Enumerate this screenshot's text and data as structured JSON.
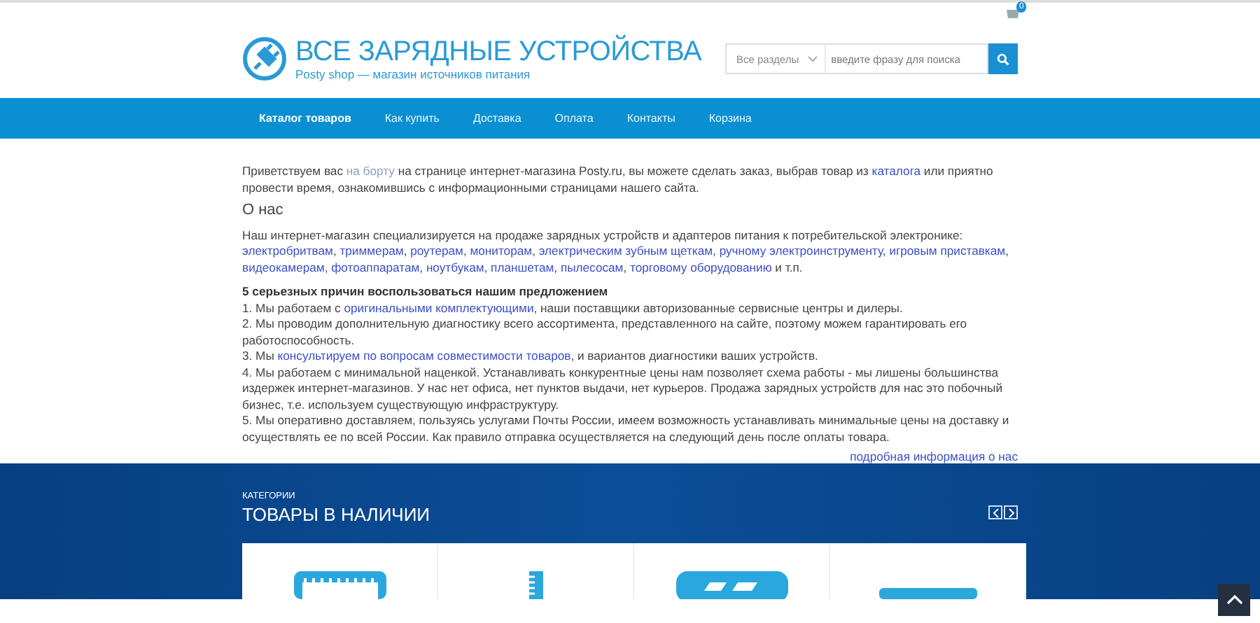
{
  "cart": {
    "count": "0"
  },
  "logo": {
    "title": "ВСЕ ЗАРЯДНЫЕ УСТРОЙСТВА",
    "subtitle": "Posty shop — магазин источников питания"
  },
  "search": {
    "section": "Все разделы",
    "placeholder": "введите фразу для поиска"
  },
  "nav": [
    {
      "label": "Каталог товаров",
      "selected": true
    },
    {
      "label": "Как купить",
      "selected": false
    },
    {
      "label": "Доставка",
      "selected": false
    },
    {
      "label": "Оплата",
      "selected": false
    },
    {
      "label": "Контакты",
      "selected": false
    },
    {
      "label": "Корзина",
      "selected": false
    }
  ],
  "intro": [
    {
      "kind": "text",
      "text": "Приветствуем вас "
    },
    {
      "kind": "faded",
      "text": "на борту"
    },
    {
      "kind": "text",
      "text": " на странице интернет-магазина Posty.ru, вы можете сделать заказ, выбрав товар из "
    },
    {
      "kind": "link",
      "text": "каталога"
    },
    {
      "kind": "text",
      "text": " или приятно провести время, ознакомившись с информационными страницами нашего сайта."
    }
  ],
  "about_heading": "О нас",
  "about": [
    {
      "kind": "text",
      "text": "Наш интернет-магазин специализируется на продаже зарядных устройств и адаптеров питания к потребительской электронике: "
    },
    {
      "kind": "link",
      "text": "электробритвам"
    },
    {
      "kind": "text",
      "text": ", "
    },
    {
      "kind": "link",
      "text": "триммерам"
    },
    {
      "kind": "text",
      "text": ", "
    },
    {
      "kind": "link",
      "text": "роутерам"
    },
    {
      "kind": "text",
      "text": ", "
    },
    {
      "kind": "link",
      "text": "мониторам"
    },
    {
      "kind": "text",
      "text": ", "
    },
    {
      "kind": "link",
      "text": "электрическим зубным щеткам"
    },
    {
      "kind": "text",
      "text": ", "
    },
    {
      "kind": "link",
      "text": "ручному электроинструменту"
    },
    {
      "kind": "text",
      "text": ", "
    },
    {
      "kind": "link",
      "text": "игровым приставкам"
    },
    {
      "kind": "text",
      "text": ", "
    },
    {
      "kind": "link",
      "text": "видеокамерам"
    },
    {
      "kind": "text",
      "text": ", "
    },
    {
      "kind": "link",
      "text": "фотоаппаратам"
    },
    {
      "kind": "text",
      "text": ", "
    },
    {
      "kind": "link",
      "text": "ноутбукам"
    },
    {
      "kind": "text",
      "text": ", "
    },
    {
      "kind": "link",
      "text": "планшетам"
    },
    {
      "kind": "text",
      "text": ", "
    },
    {
      "kind": "link",
      "text": "пылесосам"
    },
    {
      "kind": "text",
      "text": ", "
    },
    {
      "kind": "link",
      "text": "торговому оборудованию"
    },
    {
      "kind": "text",
      "text": " и т.п."
    }
  ],
  "reasons_heading": "5 серьезных причин воспользоваться нашим предложением",
  "reasons": [
    [
      {
        "kind": "text",
        "text": "1. Мы работаем с "
      },
      {
        "kind": "link",
        "text": "оригинальными комплектующими"
      },
      {
        "kind": "text",
        "text": ", наши поставщики авторизованные сервисные центры и дилеры."
      }
    ],
    [
      {
        "kind": "text",
        "text": "2. Мы проводим дополнительную диагностику всего ассортимента, представленного на сайте, поэтому можем гарантировать его работоспособность."
      }
    ],
    [
      {
        "kind": "text",
        "text": "3. Мы "
      },
      {
        "kind": "link",
        "text": "консультируем по вопросам совместимости товаров"
      },
      {
        "kind": "text",
        "text": ", и вариантов диагностики ваших устройств."
      }
    ],
    [
      {
        "kind": "text",
        "text": "4. Мы работаем с минимальной наценкой. Устанавливать конкурентные цены нам позволяет схема работы - мы лишены большинства издержек интернет-магазинов. У нас нет офиса, нет пунктов выдачи, нет курьеров. Продажа зарядных устройств для нас это побочный бизнес, т.е. используем существующую инфраструктуру."
      }
    ],
    [
      {
        "kind": "text",
        "text": "5. Мы оперативно доставляем, пользуясь услугами Почты России, имеем возможность устанавливать минимальные цены на доставку и осуществлять ее по всей России. Как правило отправка осуществляется на следующий день после оплаты товара."
      }
    ]
  ],
  "more_link": "подробная информация о нас",
  "categories": {
    "label": "КАТЕГОРИИ",
    "title": "ТОВАРЫ В НАЛИЧИИ",
    "cards": [
      {
        "kind": "battery"
      },
      {
        "kind": "ruler"
      },
      {
        "kind": "adapter"
      },
      {
        "kind": "flat"
      }
    ]
  }
}
